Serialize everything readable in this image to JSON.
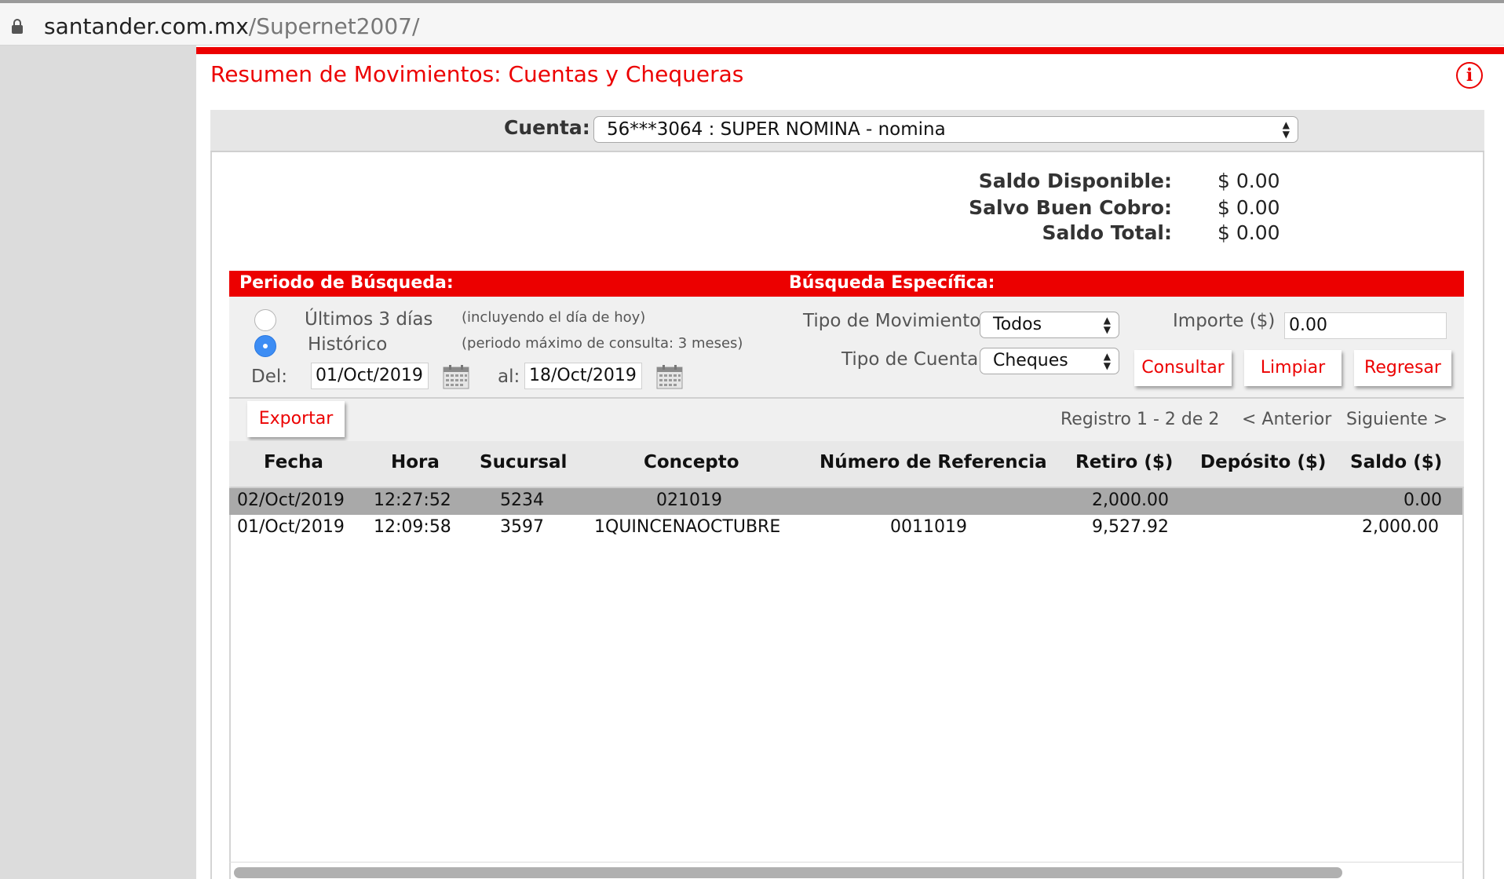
{
  "browser": {
    "url_domain": "santander.com.mx",
    "url_path": "/Supernet2007/"
  },
  "page": {
    "title": "Resumen de Movimientos: Cuentas y Chequeras"
  },
  "account": {
    "label": "Cuenta:",
    "selected": "56***3064 : SUPER NOMINA - nomina"
  },
  "balances": [
    {
      "label": "Saldo Disponible:",
      "value": "$ 0.00"
    },
    {
      "label": "Salvo Buen Cobro:",
      "value": "$ 0.00"
    },
    {
      "label": "Saldo Total:",
      "value": "$ 0.00"
    }
  ],
  "search": {
    "period_header": "Periodo de Búsqueda:",
    "specific_header": "Búsqueda Específica:",
    "option_last3": "Últimos 3 días",
    "option_last3_note": "(incluyendo el día de hoy)",
    "option_historic": "Histórico",
    "option_historic_note": "(periodo máximo de consulta: 3 meses)",
    "selected_option": "Histórico",
    "from_label": "Del:",
    "from_value": "01/Oct/2019",
    "to_label": "al:",
    "to_value": "18/Oct/2019",
    "movement_type_label": "Tipo de Movimiento",
    "movement_type_value": "Todos",
    "account_type_label": "Tipo de Cuenta",
    "account_type_value": "Cheques",
    "amount_label": "Importe ($)",
    "amount_value": "0.00",
    "consult_button": "Consultar",
    "clear_button": "Limpiar",
    "back_button": "Regresar"
  },
  "toolbar": {
    "export_button": "Exportar",
    "records_text": "Registro 1 - 2 de 2",
    "prev_link": "< Anterior",
    "next_link": "Siguiente >"
  },
  "table": {
    "columns": [
      "Fecha",
      "Hora",
      "Sucursal",
      "Concepto",
      "Número de Referencia",
      "Retiro ($)",
      "Depósito ($)",
      "Saldo ($)"
    ],
    "rows": [
      {
        "fecha": "02/Oct/2019",
        "hora": "12:27:52",
        "sucursal": "5234",
        "concepto": "021019",
        "referencia": "",
        "retiro": "2,000.00",
        "deposito": "",
        "saldo": "0.00"
      },
      {
        "fecha": "01/Oct/2019",
        "hora": "12:09:58",
        "sucursal": "3597",
        "concepto": "1QUINCENAOCTUBRE",
        "referencia": "0011019",
        "retiro": "9,527.92",
        "deposito": "",
        "saldo": "2,000.00"
      }
    ],
    "selected_row_index": 0
  },
  "colors": {
    "brand_red": "#ec0000",
    "radio_selected": "#3d8df4",
    "selected_row": "#a9a9a9"
  }
}
